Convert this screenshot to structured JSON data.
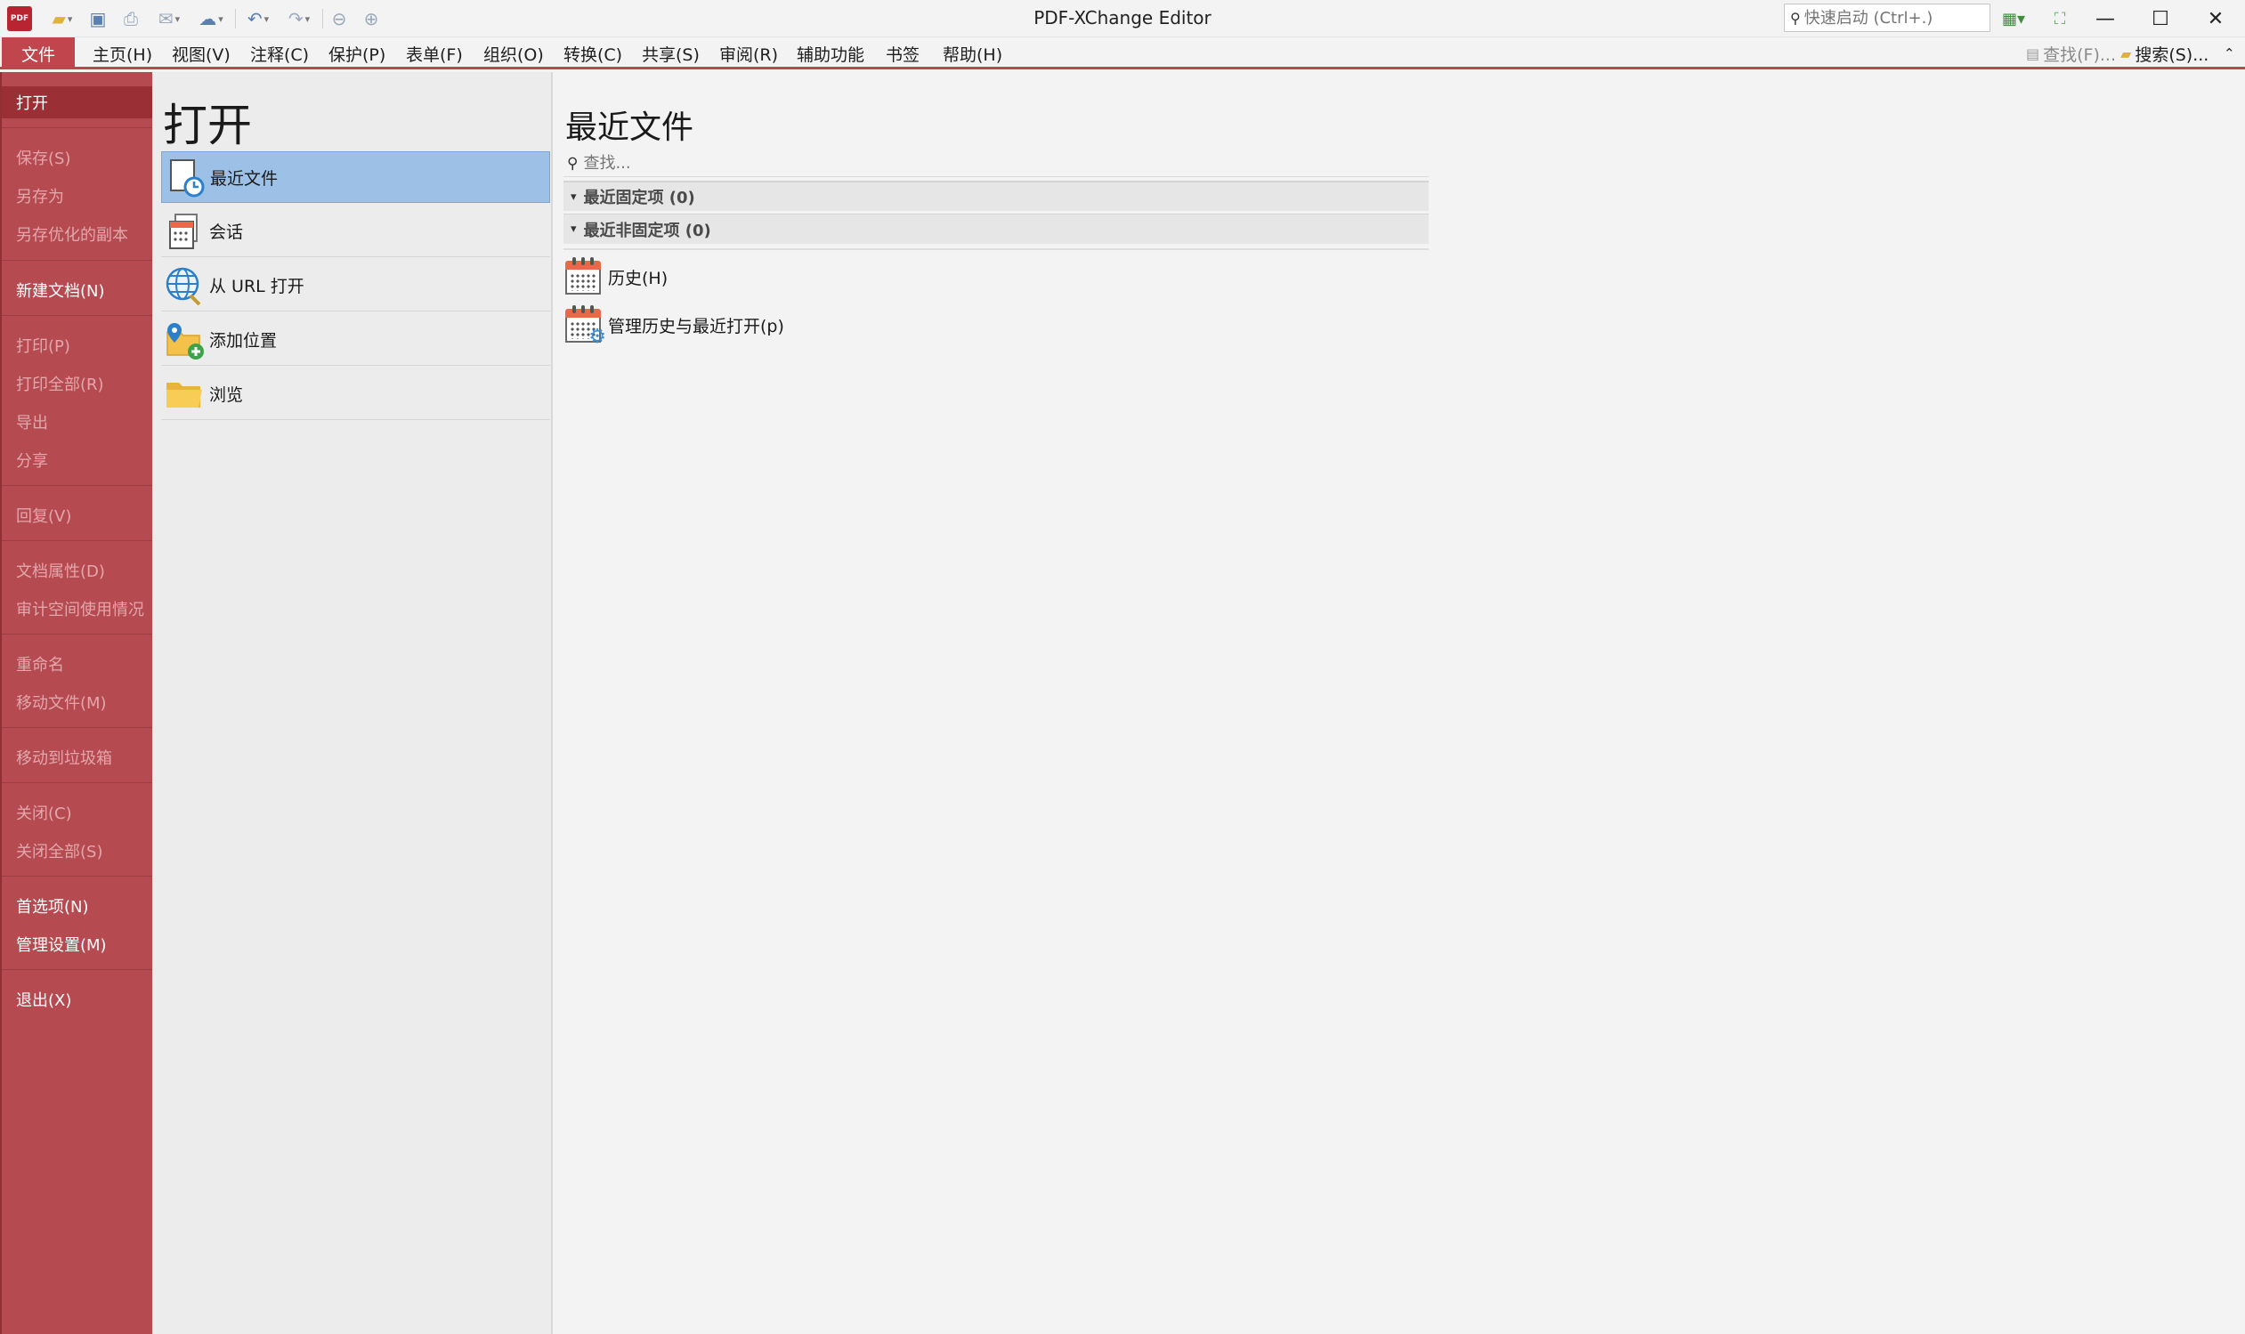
{
  "app": {
    "logo_text": "PDF",
    "title": "PDF-XChange Editor",
    "quick_launch_placeholder": "快速启动 (Ctrl+.)"
  },
  "menubar": {
    "file": "文件",
    "items": [
      "主页(H)",
      "视图(V)",
      "注释(C)",
      "保护(P)",
      "表单(F)",
      "组织(O)",
      "转换(C)",
      "共享(S)",
      "审阅(R)",
      "辅助功能",
      "书签",
      "帮助(H)"
    ],
    "find": "查找(F)...",
    "search": "搜索(S)..."
  },
  "nav": {
    "open": "打开",
    "save": "保存(S)",
    "save_as": "另存为",
    "save_optimized": "另存优化的副本",
    "new_doc": "新建文档(N)",
    "print": "打印(P)",
    "print_all": "打印全部(R)",
    "export": "导出",
    "share": "分享",
    "revert": "回复(V)",
    "doc_props": "文档属性(D)",
    "audit_space": "审计空间使用情况",
    "rename": "重命名",
    "move_file": "移动文件(M)",
    "move_trash": "移动到垃圾箱",
    "close": "关闭(C)",
    "close_all": "关闭全部(S)",
    "preferences": "首选项(N)",
    "manage_settings": "管理设置(M)",
    "exit": "退出(X)"
  },
  "open_panel": {
    "title": "打开",
    "options": [
      "最近文件",
      "会话",
      "从 URL 打开",
      "添加位置",
      "浏览"
    ]
  },
  "recent": {
    "title": "最近文件",
    "search_placeholder": "查找...",
    "pinned": "最近固定项 (0)",
    "unpinned": "最近非固定项 (0)",
    "history": "历史(H)",
    "manage_history": "管理历史与最近打开(p)"
  },
  "colors": {
    "nav_bg": "#b54a51",
    "nav_selected": "#9a3036",
    "selected_option": "#9dc1e6"
  }
}
